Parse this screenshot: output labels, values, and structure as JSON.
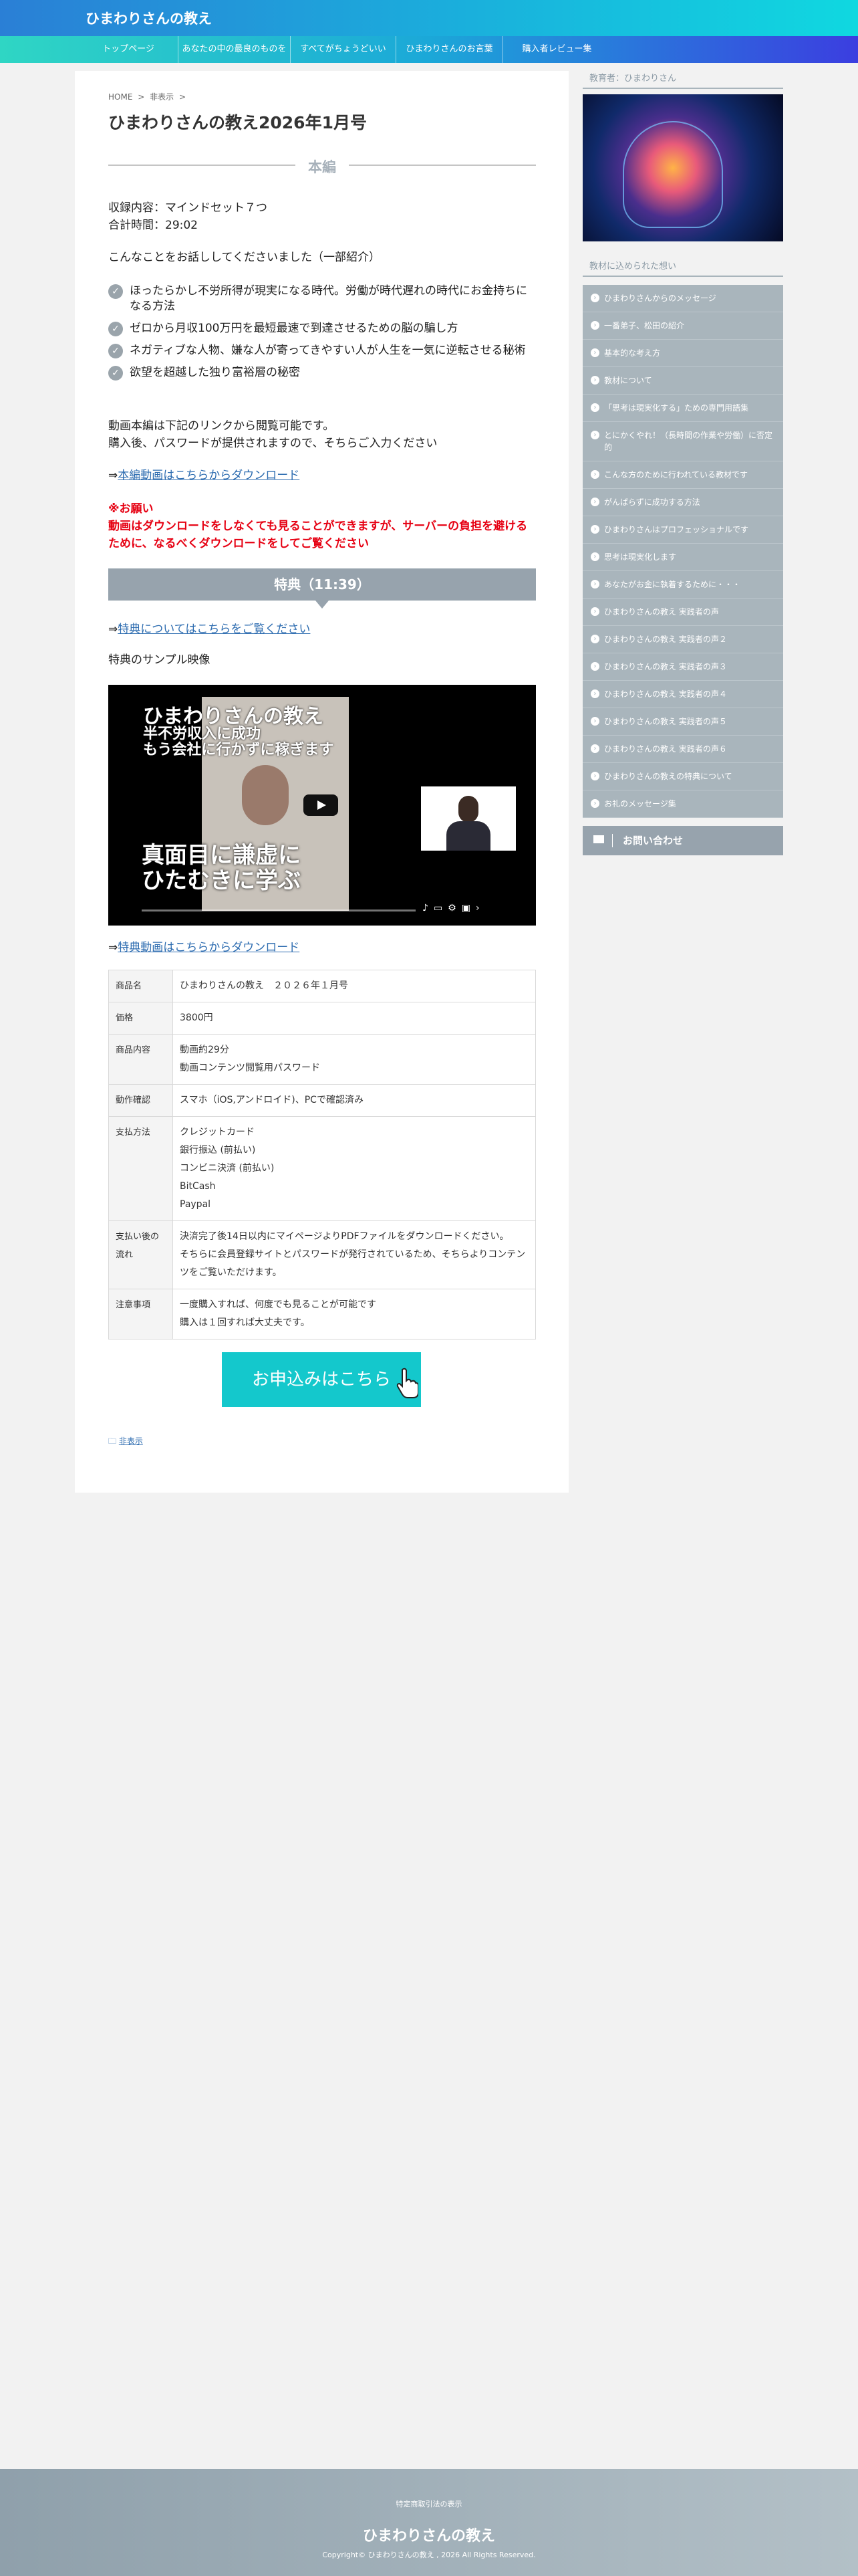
{
  "header": {
    "site_title": "ひまわりさんの教え"
  },
  "nav": [
    "トップページ",
    "あなたの中の最良のものを",
    "すべてがちょうどいい",
    "ひまわりさんのお言葉",
    "購入者レビュー集"
  ],
  "breadcrumb": {
    "home": "HOME",
    "sep1": ">",
    "category": "非表示",
    "sep2": ">"
  },
  "article": {
    "title": "ひまわりさんの教え2026年1月号",
    "section_label": "本編",
    "contents": "収録内容：マインドセット７つ",
    "runtime": "合計時間：29:02",
    "intro": "こんなことをお話ししてくださいました（一部紹介）",
    "bullets": [
      "ほったらかし不労所得が現実になる時代。労働が時代遅れの時代にお金持ちになる方法",
      "ゼロから月収100万円を最短最速で到達させるための脳の騙し方",
      "ネガティブな人物、嫌な人が寄ってきやすい人が人生を一気に逆転させる秘術",
      "欲望を超越した独り富裕層の秘密"
    ],
    "video_note1": "動画本編は下記のリンクから閲覧可能です。",
    "video_note2": "購入後、パスワードが提供されますので、そちらご入力ください",
    "arrow": "⇒",
    "download_link": "本編動画はこちらからダウンロード",
    "warn_title": "※お願い",
    "warn_body": "動画はダウンロードをしなくても見ることができますが、サーバーの負担を避けるために、なるべくダウンロードをしてご覧ください",
    "bonus_label": "特典（11:39）",
    "bonus_link": "特典についてはこちらをご覧ください",
    "sample_label": "特典のサンプル映像",
    "video_title": "ひまわりさんの教え",
    "video_sub1": "半不労収入に成功",
    "video_sub2": "もう会社に行かずに稼ぎます",
    "video_caption1": "真面目に謙虚に",
    "video_caption2": "ひたむきに学ぶ",
    "bonus_download": "特典動画はこちらからダウンロード"
  },
  "info_table": [
    {
      "label": "商品名",
      "lines": [
        "ひまわりさんの教え　２０２６年１月号"
      ]
    },
    {
      "label": "価格",
      "lines": [
        "3800円"
      ]
    },
    {
      "label": "商品内容",
      "lines": [
        "動画約29分",
        "動画コンテンツ閲覧用パスワード"
      ]
    },
    {
      "label": "動作確認",
      "lines": [
        "スマホ（iOS,アンドロイド)、PCで確認済み"
      ]
    },
    {
      "label": "支払方法",
      "lines": [
        "クレジットカード",
        "銀行振込 (前払い)",
        "コンビニ決済 (前払い)",
        "BitCash",
        "Paypal"
      ]
    },
    {
      "label": "支払い後の流れ",
      "lines": [
        "決済完了後14日以内にマイページよりPDFファイルをダウンロードください。",
        "そちらに会員登録サイトとパスワードが発行されているため、そちらよりコンテンツをご覧いただけます。"
      ]
    },
    {
      "label": "注意事項",
      "lines": [
        "一度購入すれば、何度でも見ることが可能です",
        "購入は１回すれば大丈夫です。"
      ]
    }
  ],
  "apply_button": "お申込みはこちら",
  "category_link": "非表示",
  "sidebar": {
    "author_title": "教育者：ひまわりさん",
    "menu_title": "教材に込められた想い",
    "menu": [
      "ひまわりさんからのメッセージ",
      "一番弟子、松田の紹介",
      "基本的な考え方",
      "教材について",
      "「思考は現実化する」ための専門用語集",
      "とにかくやれ！（長時間の作業や労働）に否定的",
      "こんな方のために行われている教材です",
      "がんばらずに成功する方法",
      "ひまわりさんはプロフェッショナルです",
      "思考は現実化します",
      "あなたがお金に執着するために・・・",
      "ひまわりさんの教え 実践者の声",
      "ひまわりさんの教え 実践者の声２",
      "ひまわりさんの教え 実践者の声３",
      "ひまわりさんの教え 実践者の声４",
      "ひまわりさんの教え 実践者の声５",
      "ひまわりさんの教え 実践者の声６",
      "ひまわりさんの教えの特典について",
      "お礼のメッセージ集"
    ],
    "contact": "お問い合わせ"
  },
  "footer": {
    "law": "特定商取引法の表示",
    "title": "ひまわりさんの教え",
    "copyright": "Copyright© ひまわりさんの教え , 2026 All Rights Reserved."
  }
}
